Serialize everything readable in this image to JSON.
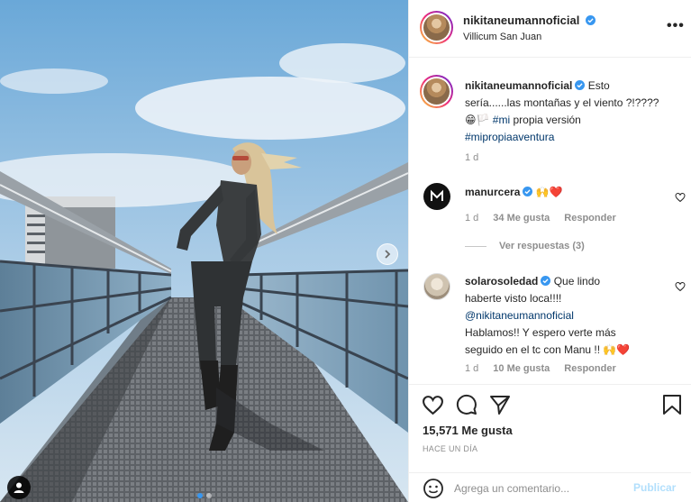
{
  "post": {
    "author": "nikitaneumannoficial",
    "location": "Villicum San Juan",
    "more_label": "•••",
    "caption": {
      "author": "nikitaneumannoficial",
      "text_1": "Esto",
      "text_2": "sería......las montañas y el viento ?!????",
      "emoji": "😁🏳️",
      "hashtag_1": "#mi",
      "text_3": "propia versión",
      "hashtag_2": "#mipropiaaventura",
      "age": "1 d"
    },
    "comments": [
      {
        "author": "manurcera",
        "text": "🙌❤️",
        "age": "1 d",
        "likes": "34 Me gusta",
        "reply": "Responder",
        "view_replies": "Ver respuestas (3)"
      },
      {
        "author": "solarosoledad",
        "text_1": "Que lindo",
        "text_2": "haberte visto loca!!!!",
        "mention": "@nikitaneumannoficial",
        "text_3": "Hablamos!! Y espero verte más",
        "text_4": "seguido en el tc con Manu !! 🙌❤️",
        "age": "1 d",
        "likes": "10 Me gusta",
        "reply": "Responder"
      }
    ],
    "likes_count": "15,571 Me gusta",
    "posted_time": "HACE UN DÍA",
    "composer": {
      "placeholder": "Agrega un comentario...",
      "publish": "Publicar"
    }
  },
  "carousel": {
    "current": 1,
    "total": 2
  },
  "colors": {
    "verified_blue": "#3897f0",
    "link_blue": "#00376b",
    "publish_disabled": "#b2dffc",
    "secondary_text": "#8e8e8e"
  },
  "icons": [
    "verified-icon",
    "more-options-icon",
    "heart-icon",
    "comment-icon",
    "share-icon",
    "bookmark-icon",
    "emoji-icon",
    "chevron-right-icon",
    "user-tag-icon"
  ]
}
